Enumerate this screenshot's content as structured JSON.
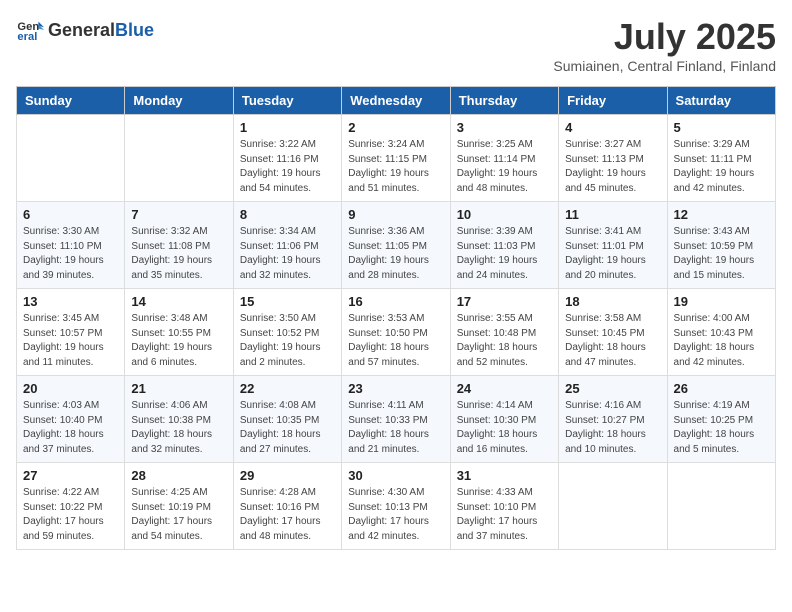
{
  "header": {
    "logo_general": "General",
    "logo_blue": "Blue",
    "month_year": "July 2025",
    "location": "Sumiainen, Central Finland, Finland"
  },
  "weekdays": [
    "Sunday",
    "Monday",
    "Tuesday",
    "Wednesday",
    "Thursday",
    "Friday",
    "Saturday"
  ],
  "weeks": [
    [
      {
        "day": "",
        "detail": ""
      },
      {
        "day": "",
        "detail": ""
      },
      {
        "day": "1",
        "detail": "Sunrise: 3:22 AM\nSunset: 11:16 PM\nDaylight: 19 hours\nand 54 minutes."
      },
      {
        "day": "2",
        "detail": "Sunrise: 3:24 AM\nSunset: 11:15 PM\nDaylight: 19 hours\nand 51 minutes."
      },
      {
        "day": "3",
        "detail": "Sunrise: 3:25 AM\nSunset: 11:14 PM\nDaylight: 19 hours\nand 48 minutes."
      },
      {
        "day": "4",
        "detail": "Sunrise: 3:27 AM\nSunset: 11:13 PM\nDaylight: 19 hours\nand 45 minutes."
      },
      {
        "day": "5",
        "detail": "Sunrise: 3:29 AM\nSunset: 11:11 PM\nDaylight: 19 hours\nand 42 minutes."
      }
    ],
    [
      {
        "day": "6",
        "detail": "Sunrise: 3:30 AM\nSunset: 11:10 PM\nDaylight: 19 hours\nand 39 minutes."
      },
      {
        "day": "7",
        "detail": "Sunrise: 3:32 AM\nSunset: 11:08 PM\nDaylight: 19 hours\nand 35 minutes."
      },
      {
        "day": "8",
        "detail": "Sunrise: 3:34 AM\nSunset: 11:06 PM\nDaylight: 19 hours\nand 32 minutes."
      },
      {
        "day": "9",
        "detail": "Sunrise: 3:36 AM\nSunset: 11:05 PM\nDaylight: 19 hours\nand 28 minutes."
      },
      {
        "day": "10",
        "detail": "Sunrise: 3:39 AM\nSunset: 11:03 PM\nDaylight: 19 hours\nand 24 minutes."
      },
      {
        "day": "11",
        "detail": "Sunrise: 3:41 AM\nSunset: 11:01 PM\nDaylight: 19 hours\nand 20 minutes."
      },
      {
        "day": "12",
        "detail": "Sunrise: 3:43 AM\nSunset: 10:59 PM\nDaylight: 19 hours\nand 15 minutes."
      }
    ],
    [
      {
        "day": "13",
        "detail": "Sunrise: 3:45 AM\nSunset: 10:57 PM\nDaylight: 19 hours\nand 11 minutes."
      },
      {
        "day": "14",
        "detail": "Sunrise: 3:48 AM\nSunset: 10:55 PM\nDaylight: 19 hours\nand 6 minutes."
      },
      {
        "day": "15",
        "detail": "Sunrise: 3:50 AM\nSunset: 10:52 PM\nDaylight: 19 hours\nand 2 minutes."
      },
      {
        "day": "16",
        "detail": "Sunrise: 3:53 AM\nSunset: 10:50 PM\nDaylight: 18 hours\nand 57 minutes."
      },
      {
        "day": "17",
        "detail": "Sunrise: 3:55 AM\nSunset: 10:48 PM\nDaylight: 18 hours\nand 52 minutes."
      },
      {
        "day": "18",
        "detail": "Sunrise: 3:58 AM\nSunset: 10:45 PM\nDaylight: 18 hours\nand 47 minutes."
      },
      {
        "day": "19",
        "detail": "Sunrise: 4:00 AM\nSunset: 10:43 PM\nDaylight: 18 hours\nand 42 minutes."
      }
    ],
    [
      {
        "day": "20",
        "detail": "Sunrise: 4:03 AM\nSunset: 10:40 PM\nDaylight: 18 hours\nand 37 minutes."
      },
      {
        "day": "21",
        "detail": "Sunrise: 4:06 AM\nSunset: 10:38 PM\nDaylight: 18 hours\nand 32 minutes."
      },
      {
        "day": "22",
        "detail": "Sunrise: 4:08 AM\nSunset: 10:35 PM\nDaylight: 18 hours\nand 27 minutes."
      },
      {
        "day": "23",
        "detail": "Sunrise: 4:11 AM\nSunset: 10:33 PM\nDaylight: 18 hours\nand 21 minutes."
      },
      {
        "day": "24",
        "detail": "Sunrise: 4:14 AM\nSunset: 10:30 PM\nDaylight: 18 hours\nand 16 minutes."
      },
      {
        "day": "25",
        "detail": "Sunrise: 4:16 AM\nSunset: 10:27 PM\nDaylight: 18 hours\nand 10 minutes."
      },
      {
        "day": "26",
        "detail": "Sunrise: 4:19 AM\nSunset: 10:25 PM\nDaylight: 18 hours\nand 5 minutes."
      }
    ],
    [
      {
        "day": "27",
        "detail": "Sunrise: 4:22 AM\nSunset: 10:22 PM\nDaylight: 17 hours\nand 59 minutes."
      },
      {
        "day": "28",
        "detail": "Sunrise: 4:25 AM\nSunset: 10:19 PM\nDaylight: 17 hours\nand 54 minutes."
      },
      {
        "day": "29",
        "detail": "Sunrise: 4:28 AM\nSunset: 10:16 PM\nDaylight: 17 hours\nand 48 minutes."
      },
      {
        "day": "30",
        "detail": "Sunrise: 4:30 AM\nSunset: 10:13 PM\nDaylight: 17 hours\nand 42 minutes."
      },
      {
        "day": "31",
        "detail": "Sunrise: 4:33 AM\nSunset: 10:10 PM\nDaylight: 17 hours\nand 37 minutes."
      },
      {
        "day": "",
        "detail": ""
      },
      {
        "day": "",
        "detail": ""
      }
    ]
  ]
}
